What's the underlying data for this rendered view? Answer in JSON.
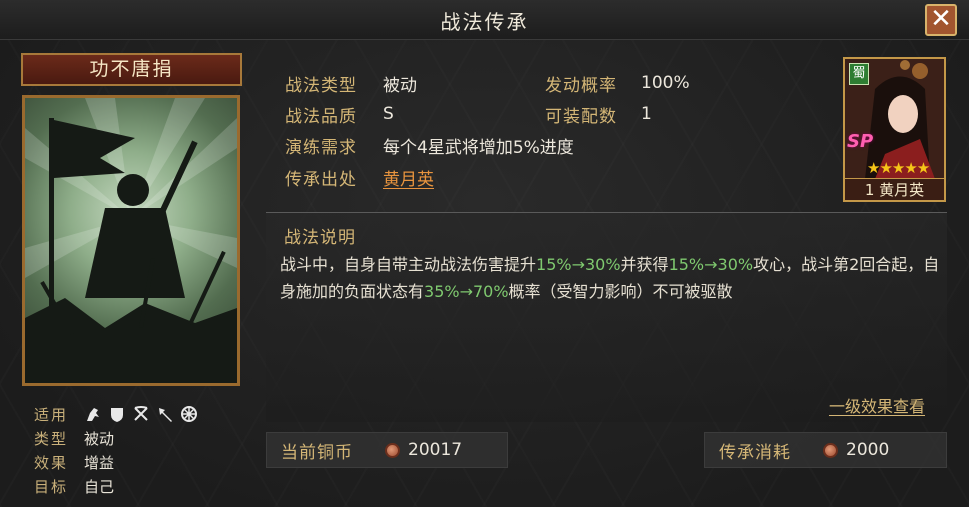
{
  "window": {
    "title": "战法传承"
  },
  "card": {
    "name": "功不唐捐",
    "meta": [
      {
        "key": "适用",
        "value": ""
      },
      {
        "key": "类型",
        "value": "被动"
      },
      {
        "key": "效果",
        "value": "增益"
      },
      {
        "key": "目标",
        "value": "自己"
      }
    ],
    "troop_icons": [
      "cavalry-icon",
      "shield-icon",
      "bow-icon",
      "spear-icon",
      "siege-wheel-icon"
    ]
  },
  "info": {
    "type_label": "战法类型",
    "type_value": "被动",
    "grade_label": "战法品质",
    "grade_value": "S",
    "req_label": "演练需求",
    "req_value": "每个4星武将增加5%进度",
    "source_label": "传承出处",
    "source_value": "黄月英",
    "prob_label": "发动概率",
    "prob_value": "100%",
    "equip_label": "可装配数",
    "equip_value": "1"
  },
  "hero": {
    "faction": "蜀",
    "tag": "SP",
    "stars": "★★★★★",
    "level_name": "1 黄月英"
  },
  "description": {
    "title": "战法说明",
    "part1": "战斗中，自身自带主动战法伤害提升",
    "hl1": "15%→30%",
    "part2": "并获得",
    "hl2": "15%→30%",
    "part3": "攻心，战斗第2回合起，自身施加的负面状态有",
    "hl3": "35%→70%",
    "part4": "概率（受智力影响）不可被驱散",
    "level_link": "一级效果查看"
  },
  "footer": {
    "coin_label": "当前铜币",
    "coin_value": "20017",
    "cost_label": "传承消耗",
    "cost_value": "2000"
  }
}
